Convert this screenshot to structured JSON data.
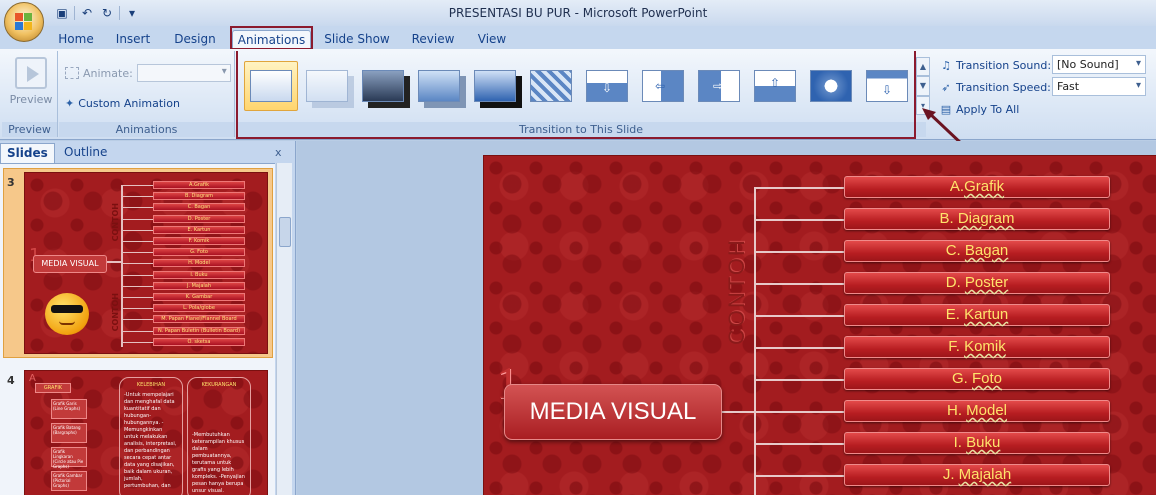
{
  "window": {
    "title": "PRESENTASI BU PUR  -  Microsoft PowerPoint"
  },
  "quick_access": [
    {
      "icon": "save-icon",
      "glyph": "▣"
    },
    {
      "icon": "undo-icon",
      "glyph": "↶"
    },
    {
      "icon": "redo-icon",
      "glyph": "↻"
    },
    {
      "icon": "customize-qat-icon",
      "glyph": "▾"
    }
  ],
  "tabs": [
    "Home",
    "Insert",
    "Design",
    "Animations",
    "Slide Show",
    "Review",
    "View"
  ],
  "active_tab": "Animations",
  "ribbon": {
    "preview": {
      "label": "Preview",
      "group": "Preview"
    },
    "animations": {
      "animate_label": "Animate:",
      "custom_animation": "Custom Animation",
      "group": "Animations"
    },
    "transition": {
      "group": "Transition to This Slide",
      "sound_label": "Transition Sound:",
      "sound_value": "[No Sound]",
      "speed_label": "Transition Speed:",
      "speed_value": "Fast",
      "apply_all": "Apply To All"
    }
  },
  "slides_panel": {
    "tabs": [
      "Slides",
      "Outline"
    ],
    "close": "x",
    "slide3": {
      "number": "3",
      "items": [
        "A.Grafik",
        "B. Diagram",
        "C. Bagan",
        "D. Poster",
        "E. Kartun",
        "F. Komik",
        "G. Foto",
        "H. Model",
        "I. Buku",
        "J. Majalah",
        "K. Gambar",
        "L. Pola/globe",
        "M. Papan Flanel/Flannel Board",
        "N. Papan Buletin (Bulletin Board)",
        "O. sketsa"
      ],
      "mv": "MEDIA VISUAL",
      "contoh": "CONTOH"
    },
    "slide4": {
      "number": "4",
      "heading": "GRAFIK",
      "kelebihan": "KELEBIHAN",
      "kekurangan": "KEKURANGAN",
      "items": [
        "Grafik Garis (Line Graphs)",
        "Grafik Batang (Bargraphs)",
        "Grafik Lingkaran (Circle atau Pie Graphs)",
        "Grafik Gambar (Pictorial Graphs)"
      ],
      "kelebihan_text": "-Untuk mempelajari dan menghafal data kuantitatif dan hubungan-hubungannya. -Memungkinkan untuk melakukan analisis, interpretasi, dan perbandingan secara cepat antar data yang disajikan, baik dalam ukuran, jumlah, pertumbuhan, dan",
      "kekurangan_text": "-Membutuhkan keterampilan khusus dalam pembuatannya, terutama untuk grafis yang lebih kompleks. -Penyajian pesan hanya berupa unsur visual."
    }
  },
  "main_slide": {
    "number": "1",
    "title": "MEDIA VISUAL",
    "vertical_label": "CONTOH",
    "items": [
      {
        "prefix": "A.",
        "word": "Grafik"
      },
      {
        "prefix": "B. ",
        "word": "Diagram"
      },
      {
        "prefix": "C. ",
        "word": "Bagan"
      },
      {
        "prefix": "D. ",
        "word": "Poster"
      },
      {
        "prefix": "E. ",
        "word": "Kartun"
      },
      {
        "prefix": "F. ",
        "word": "Komik"
      },
      {
        "prefix": "G. ",
        "word": "Foto"
      },
      {
        "prefix": "H. ",
        "word": "Model"
      },
      {
        "prefix": "I. ",
        "word": "Buku"
      },
      {
        "prefix": "J. ",
        "word": "Majalah"
      }
    ]
  },
  "colors": {
    "accent_highlight": "#8b1a2e",
    "slide_red": "#a31c1f",
    "item_text": "#ffe36b"
  }
}
